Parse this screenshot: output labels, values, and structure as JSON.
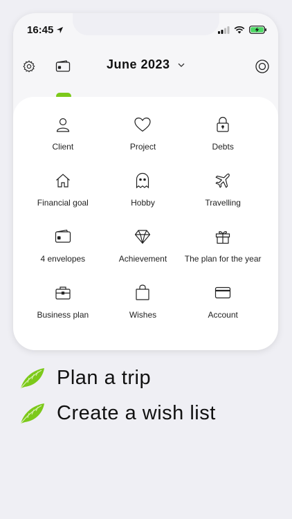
{
  "status": {
    "time": "16:45"
  },
  "header": {
    "month": "June 2023"
  },
  "grid": [
    {
      "label": "Client",
      "icon": "person-icon"
    },
    {
      "label": "Project",
      "icon": "heart-icon"
    },
    {
      "label": "Debts",
      "icon": "lock-icon"
    },
    {
      "label": "Financial goal",
      "icon": "home-icon"
    },
    {
      "label": "Hobby",
      "icon": "ghost-icon"
    },
    {
      "label": "Travelling",
      "icon": "airplane-icon"
    },
    {
      "label": "4 envelopes",
      "icon": "wallet-icon"
    },
    {
      "label": "Achievement",
      "icon": "diamond-icon"
    },
    {
      "label": "The plan for the year",
      "icon": "gift-icon"
    },
    {
      "label": "Business plan",
      "icon": "briefcase-icon"
    },
    {
      "label": "Wishes",
      "icon": "shopping-bag-icon"
    },
    {
      "label": "Account",
      "icon": "credit-card-icon"
    }
  ],
  "promo": {
    "line1": "Plan a trip",
    "line2": "Create a wish list"
  },
  "colors": {
    "accent": "#7cc91a",
    "background": "#efeff4"
  }
}
